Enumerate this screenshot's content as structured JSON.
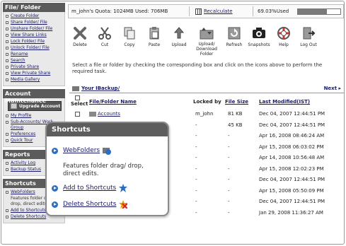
{
  "sidebar": {
    "file_folder": {
      "title": "File/ Folder",
      "items": [
        "Create Folder",
        "Share Folder/ File",
        "Unshare Folder/ File",
        "View Share Links",
        "Lock Folder/ File",
        "Unlock Folder/ File",
        "Rename",
        "Search",
        "Private Share",
        "View Private Share",
        "Media Gallery"
      ]
    },
    "account": {
      "title": "Account Maintenance",
      "upgrade_label": "Upgrade Account",
      "items": [
        "My Profile",
        "Sub-Accounts/ Work Group",
        "Preferences",
        "Quick Tour"
      ]
    },
    "reports": {
      "title": "Reports",
      "items": [
        "Activity Log",
        "Backup Status"
      ]
    },
    "shortcuts": {
      "title": "Shortcuts",
      "items": [
        "WebFolders",
        "Features folder drag/ drop, direct edits.",
        "Add to Shortcuts",
        "Delete Shortcuts"
      ]
    }
  },
  "topbar": {
    "quota_text": "m_john's Quota: 1024MB Used: 706MB",
    "recalculate": "Recalculate",
    "used_text": "69.03%Used",
    "used_fraction": 0.6903
  },
  "toolbar": [
    "Delete",
    "Cut",
    "Copy",
    "Paste",
    "Upload",
    "Upload/ Download Folder",
    "Refresh",
    "Snapshots",
    "Help",
    "Log Out"
  ],
  "hint": "Select a file or folder by checking the corresponding box and click on the icons above to perform the required task.",
  "path": {
    "label": "Your IBackup/",
    "next": "Next"
  },
  "table": {
    "headers": {
      "select": "Select",
      "name": "File/Folder Name",
      "locked": "Locked by",
      "size": "File Size",
      "modified": "Last Modified(IST)"
    },
    "rows": [
      {
        "name": "Accounts",
        "locked": "m_john",
        "size": "81 KB",
        "modified": "Dec 04, 2007 12:44:51 PM"
      },
      {
        "name": "",
        "locked": "-",
        "size": "45 KB",
        "modified": "Dec 04, 2007 12:44:51 PM"
      },
      {
        "name": "",
        "locked": "-",
        "size": "-",
        "modified": "Apr 16, 2008 08:46:24 AM"
      },
      {
        "name": "",
        "locked": "-",
        "size": "-",
        "modified": "Apr 15, 2008 06:03:02 PM"
      },
      {
        "name": "",
        "locked": "-",
        "size": "-",
        "modified": "Apr 14, 2008 10:56:48 AM"
      },
      {
        "name": "",
        "locked": "-",
        "size": "-",
        "modified": "Apr 15, 2008 12:02:23 PM"
      },
      {
        "name": "",
        "locked": "-",
        "size": "-",
        "modified": "Dec 04, 2007 12:44:51 PM"
      },
      {
        "name": "",
        "locked": "-",
        "size": "-",
        "modified": "Apr 15, 2008 05:50:09 PM"
      },
      {
        "name": "",
        "locked": "-",
        "size": "-",
        "modified": "Dec 04, 2007 12:44:51 PM"
      },
      {
        "name": "",
        "locked": "-",
        "size": "-",
        "modified": "Jan 29, 2008 11:36:27 AM"
      }
    ]
  },
  "popup": {
    "title": "Shortcuts",
    "webfolders": "WebFolders",
    "desc": "Features folder drag/ drop, direct edits.",
    "add": "Add to Shortcuts",
    "delete": "Delete Shortcuts"
  },
  "icons": {
    "delete": "delete-icon",
    "cut": "scissors-icon",
    "copy": "copy-icon",
    "paste": "paste-icon",
    "upload": "upload-icon",
    "upload_download": "upload-download-folder-icon",
    "refresh": "refresh-icon",
    "snapshots": "camera-icon",
    "help": "lifebuoy-icon",
    "logout": "logout-icon"
  }
}
